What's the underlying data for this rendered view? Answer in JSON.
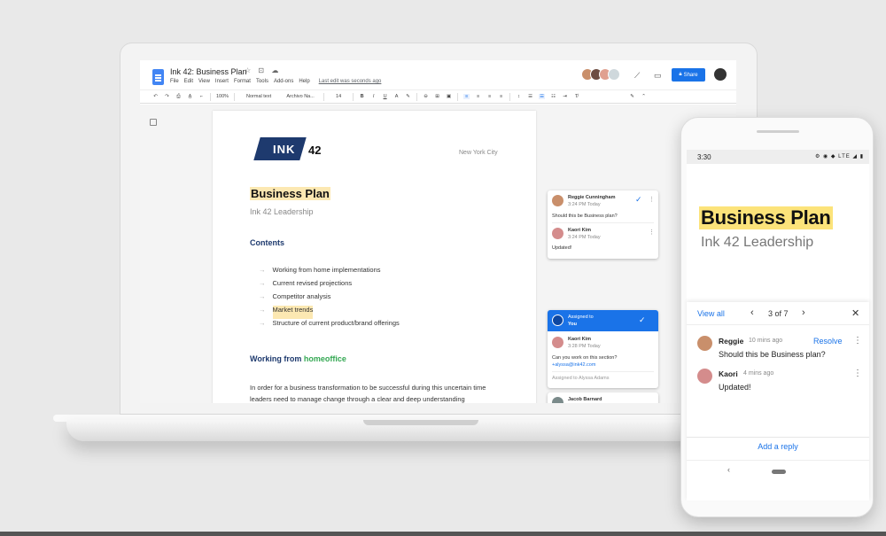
{
  "colors": {
    "brand_blue": "#1a73e8",
    "navy": "#1e3a6e",
    "highlight": "#fce8b2",
    "green": "#34a853"
  },
  "doc": {
    "title": "Ink 42: Business Plan",
    "title_icons": "☆ ⊡ ☁",
    "menus": [
      "File",
      "Edit",
      "View",
      "Insert",
      "Format",
      "Tools",
      "Add-ons",
      "Help"
    ],
    "last_edit": "Last edit was seconds ago",
    "share_label": "Share"
  },
  "toolbar": {
    "zoom": "100%",
    "style": "Normal text",
    "font": "Archivo Na...",
    "size": "14",
    "icons": [
      "undo-icon",
      "redo-icon",
      "print-icon",
      "spellcheck-icon",
      "paint-format-icon",
      "bold-icon",
      "italic-icon",
      "underline-icon",
      "text-color-icon",
      "highlight-icon",
      "link-icon",
      "comment-icon",
      "image-icon",
      "align-left-icon",
      "align-center-icon",
      "align-right-icon",
      "justify-icon",
      "line-spacing-icon",
      "checklist-icon",
      "bullet-list-icon",
      "numbered-list-icon",
      "indent-icon",
      "clear-format-icon",
      "edit-mode-icon"
    ]
  },
  "page": {
    "logo_ink": "INK",
    "logo_num": "42",
    "city": "New York City",
    "title": "Business Plan",
    "subtitle": "Ink 42 Leadership",
    "contents_heading": "Contents",
    "toc": [
      "Working from home implementations",
      "Current revised projections",
      "Competitor analysis",
      "Market trends",
      "Structure of current product/brand offerings"
    ],
    "section_heading_a": "Working from ",
    "section_heading_b": "homeoffice",
    "body": "In order for a business transformation to be successful during this uncertain time leaders need to manage change through a clear and deep understanding"
  },
  "comments": {
    "c1": {
      "name": "Reggie Cunningham",
      "time": "3:24 PM Today",
      "text": "Should this be Business plan?"
    },
    "c1_reply": {
      "name": "Kaori Kim",
      "time": "3:24 PM Today",
      "text": "Updated!"
    },
    "assigned_label": "Assigned to",
    "assigned_to": "You",
    "c2": {
      "name": "Kaori Kim",
      "time": "3:28 PM Today",
      "text": "Can you work on this section?",
      "mention": "+alyssa@ink42.com",
      "footer": "Assigned to Alyssa Adams"
    },
    "c3": {
      "name": "Jacob Barnard"
    }
  },
  "phone": {
    "time": "3:30",
    "status_icons": "⚙ ◉ ◆ LTE ◢ ▮",
    "title": "Business Plan",
    "subtitle": "Ink 42 Leadership",
    "view_all": "View all",
    "counter": "3 of 7",
    "resolve": "Resolve",
    "c1": {
      "name": "Reggie",
      "time": "10 mins ago",
      "text": "Should this be Business plan?"
    },
    "c2": {
      "name": "Kaori",
      "time": "4 mins ago",
      "text": "Updated!"
    },
    "add_reply": "Add a reply"
  }
}
